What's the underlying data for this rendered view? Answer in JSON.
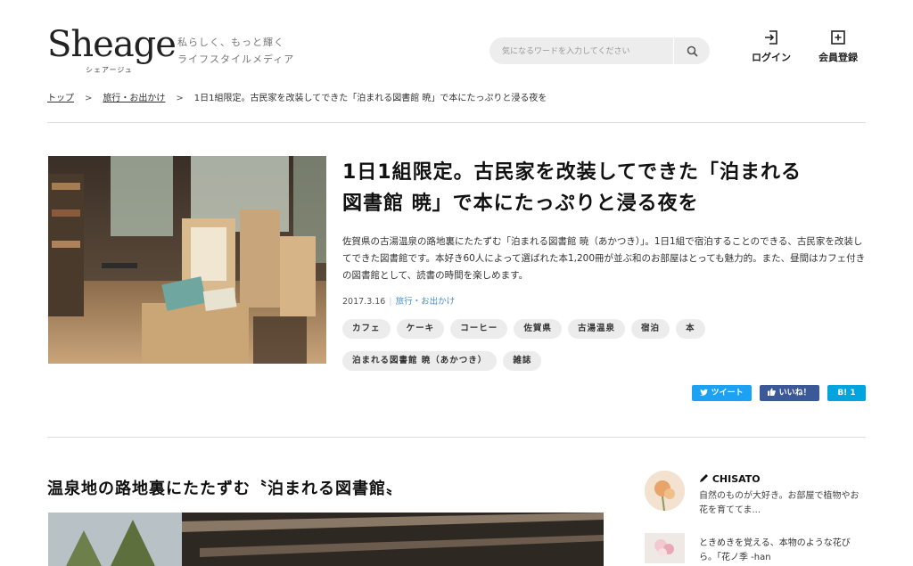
{
  "header": {
    "logo_main": "Sheage",
    "logo_sub": "シェアージュ",
    "tagline_line1": "私らしく、もっと輝く",
    "tagline_line2": "ライフスタイルメディア",
    "search_placeholder": "気になるワードを入力してください",
    "login_label": "ログイン",
    "register_label": "会員登録"
  },
  "breadcrumb": {
    "home": "トップ",
    "category": "旅行・お出かけ",
    "current": "1日1組限定。古民家を改装してできた「泊まれる図書館 暁」で本にたっぷりと浸る夜を"
  },
  "article": {
    "title_line1": "1日1組限定。古民家を改装してできた「泊まれる",
    "title_line2": "図書館 暁」で本にたっぷりと浸る夜を",
    "lead": "佐賀県の古湯温泉の路地裏にたたずむ「泊まれる図書館 暁（あかつき）」。1日1組で宿泊することのできる、古民家を改装してできた図書館です。本好き60人によって選ばれた本1,200冊が並ぶ和のお部屋はとっても魅力的。また、昼間はカフェ付きの図書館として、読書の時間を楽しめます。",
    "date": "2017.3.16",
    "divider": "|",
    "category": "旅行・お出かけ",
    "tags": [
      "カフェ",
      "ケーキ",
      "コーヒー",
      "佐賀県",
      "古湯温泉",
      "宿泊",
      "本",
      "泊まれる図書館 暁（あかつき）",
      "雑誌"
    ],
    "share": {
      "tweet": "ツイート",
      "like": "いいね！",
      "hatena": "B! 1"
    }
  },
  "section": {
    "heading": "温泉地の路地裏にたたずむ〝泊まれる図書館〟"
  },
  "sidebar": {
    "author_name": "CHISATO",
    "author_bio": "自然のものが大好き。お部屋で植物やお花を育ててま...",
    "related_title": "ときめきを覚える、本物のような花びら。「花ノ季 -han"
  },
  "colors": {
    "twitter": "#1da1f2",
    "facebook": "#3b5998",
    "hatena": "#00a4de",
    "link_category": "#4a90c8"
  }
}
